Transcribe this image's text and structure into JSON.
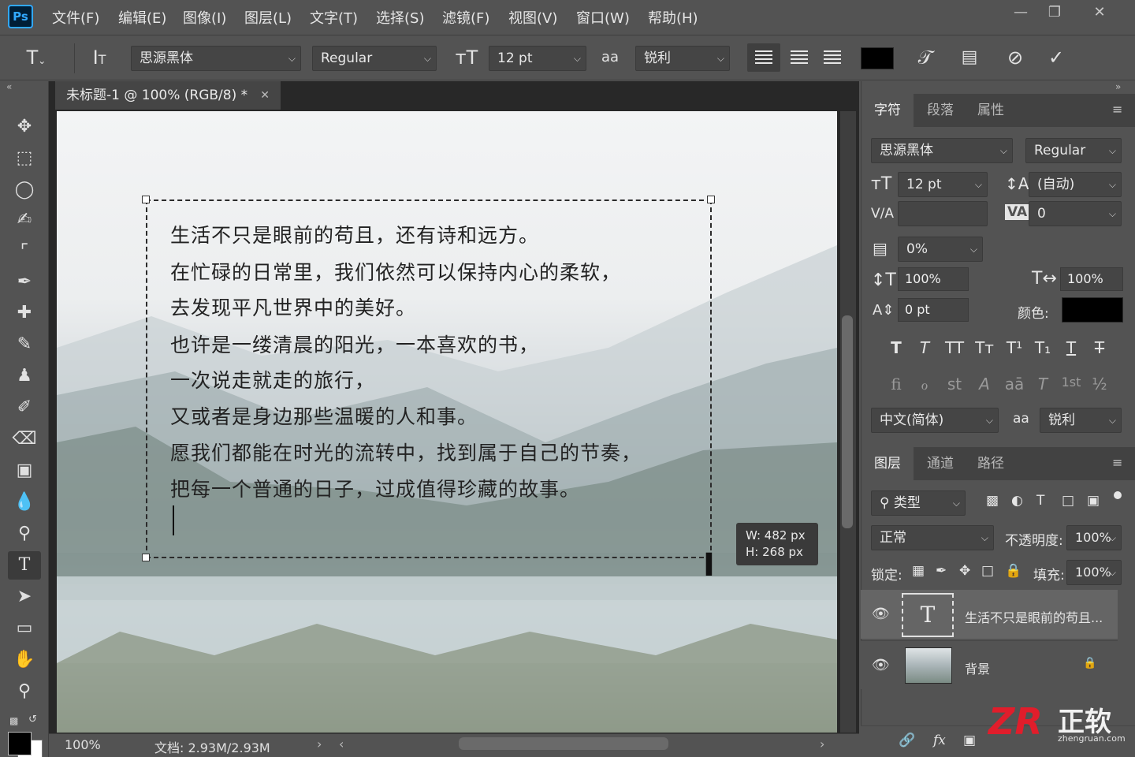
{
  "menubar": {
    "logo": "Ps",
    "items": [
      "文件(F)",
      "编辑(E)",
      "图像(I)",
      "图层(L)",
      "文字(T)",
      "选择(S)",
      "滤镜(F)",
      "视图(V)",
      "窗口(W)",
      "帮助(H)"
    ],
    "window_buttons": [
      "—",
      "❐",
      "✕"
    ]
  },
  "options": {
    "font_family": "思源黑体",
    "font_style": "Regular",
    "font_size": "12 pt",
    "aa_label": "aa",
    "anti_alias": "锐利",
    "text_color": "#000000"
  },
  "document": {
    "tab_title": "未标题-1 @ 100% (RGB/8) *",
    "lines": [
      "生活不只是眼前的苟且，还有诗和远方。",
      "在忙碌的日常里，我们依然可以保持内心的柔软，",
      "去发现平凡世界中的美好。",
      "也许是一缕清晨的阳光，一本喜欢的书，",
      "一次说走就走的旅行，",
      "又或者是身边那些温暖的人和事。",
      "愿我们都能在时光的流转中，找到属于自己的节奏，",
      "把每一个普通的日子，过成值得珍藏的故事。"
    ],
    "dim_w": "W:  482 px",
    "dim_h": "H:  268 px"
  },
  "status": {
    "zoom": "100%",
    "doc_size": "文档: 2.93M/2.93M"
  },
  "character_panel": {
    "tabs": [
      "字符",
      "段落",
      "属性"
    ],
    "font_family": "思源黑体",
    "font_style": "Regular",
    "size": "12 pt",
    "leading": "(自动)",
    "kerning_label": "V/A",
    "kerning": "",
    "tracking_label": "VA",
    "tracking": "0",
    "scale_pct": "0%",
    "vscale": "100%",
    "hscale": "100%",
    "baseline": "0 pt",
    "color_label": "颜色:",
    "color": "#000000",
    "style_buttons": [
      "T",
      "T",
      "TT",
      "Tт",
      "T¹",
      "T₁",
      "T",
      "T"
    ],
    "ot_buttons": [
      "fi",
      "ℴ",
      "st",
      "A",
      "aā",
      "T",
      "1st",
      "½"
    ],
    "language": "中文(简体)",
    "aa_label": "aa",
    "anti_alias": "锐利"
  },
  "layers_panel": {
    "tabs": [
      "图层",
      "通道",
      "路径"
    ],
    "filter": "类型",
    "blend_mode": "正常",
    "opacity_label": "不透明度:",
    "opacity": "100%",
    "lock_label": "锁定:",
    "fill_label": "填充:",
    "fill": "100%",
    "layers": [
      {
        "name": "生活不只是眼前的苟且...",
        "type": "text"
      },
      {
        "name": "背景",
        "type": "image"
      }
    ]
  },
  "watermark": {
    "logo_text": "ZR",
    "brand": "正软",
    "url": "zhengruan.com"
  }
}
